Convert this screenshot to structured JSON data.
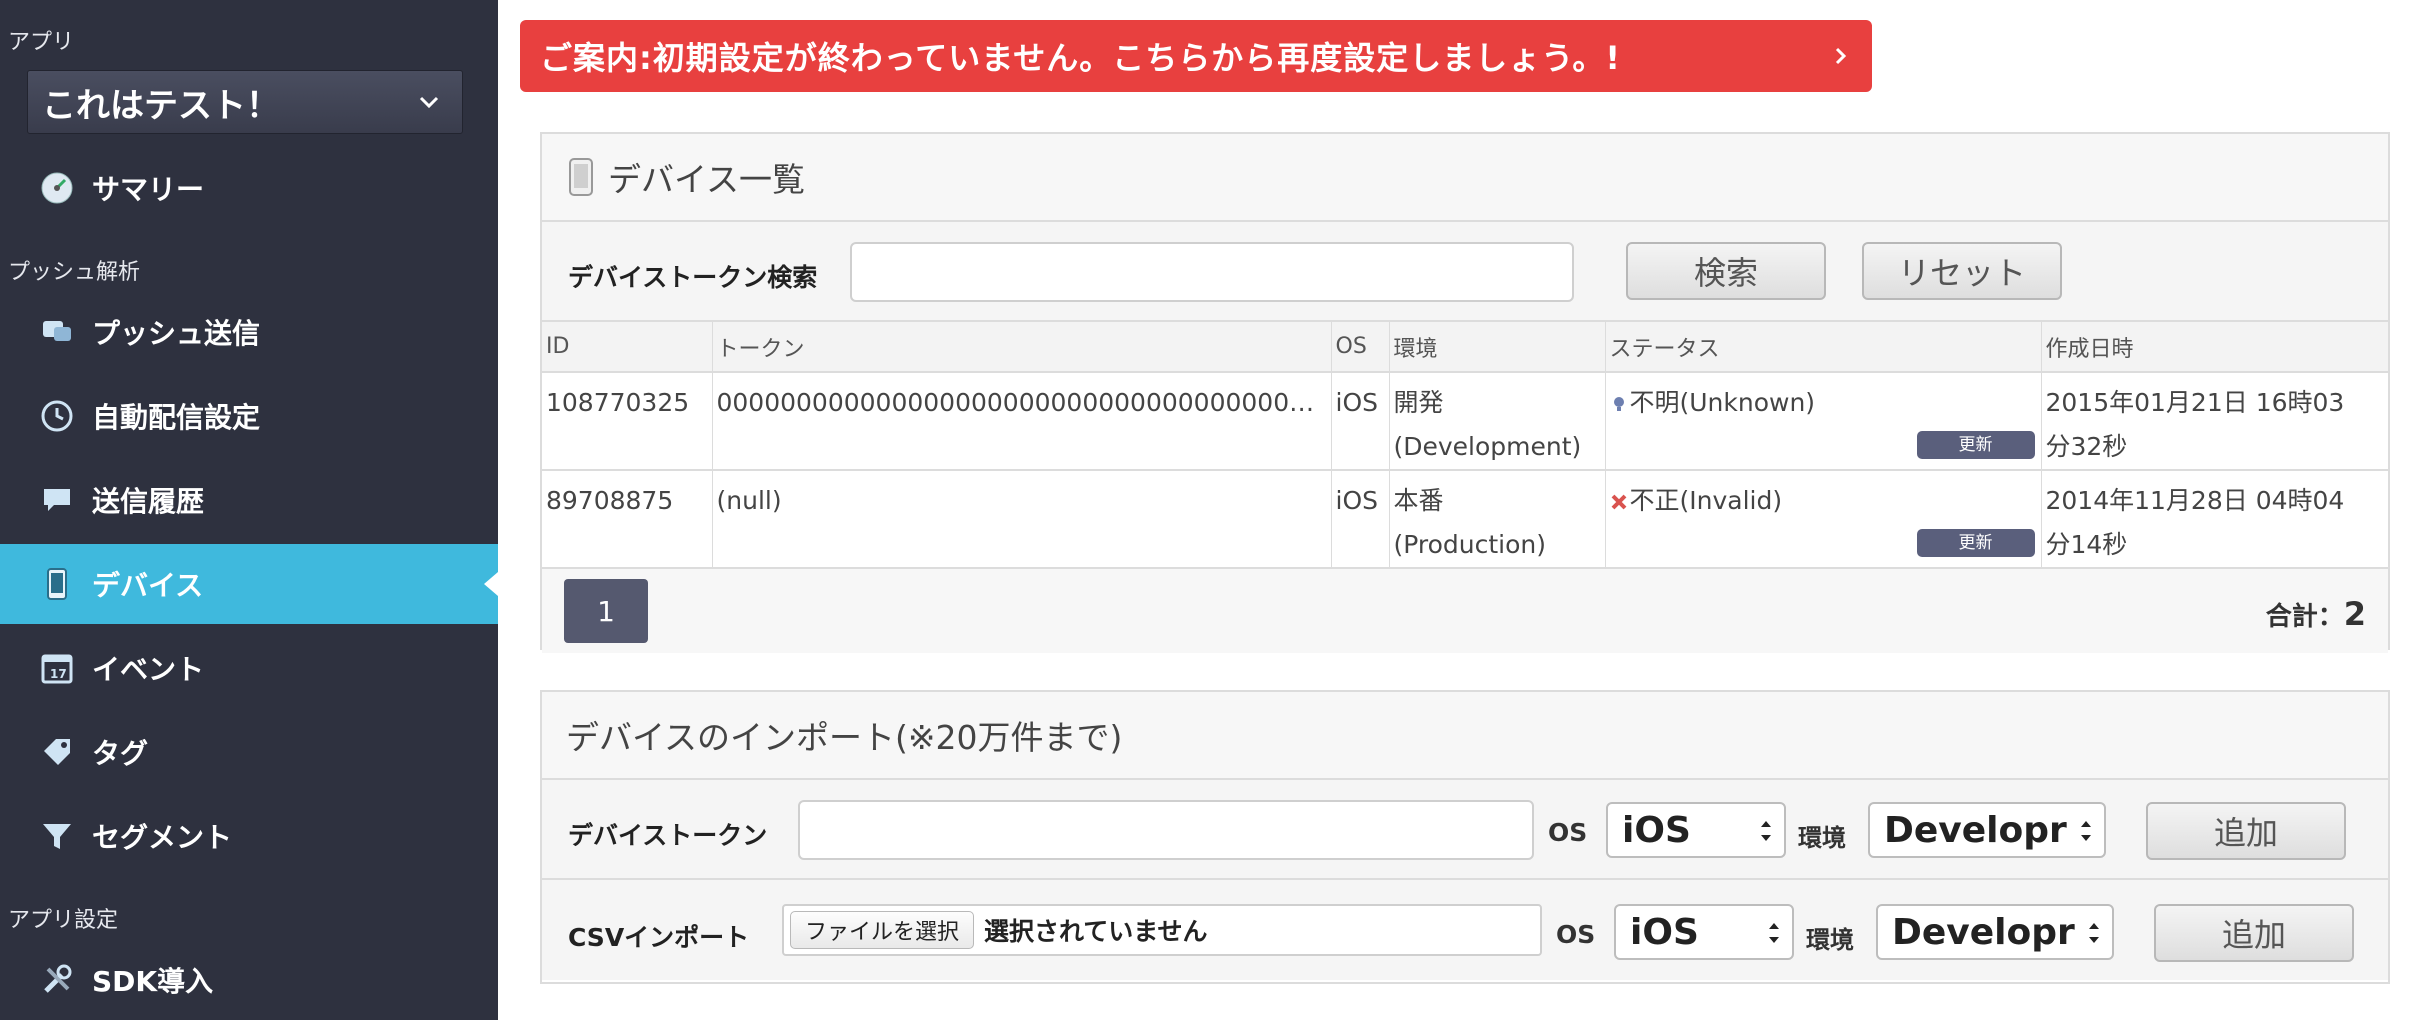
{
  "sidebar": {
    "section_app": "アプリ",
    "app_selected": "これはテスト！",
    "item_summary": "サマリー",
    "section_push": "プッシュ解析",
    "item_push_send": "プッシュ送信",
    "item_auto": "自動配信設定",
    "item_history": "送信履歴",
    "item_device": "デバイス",
    "item_event": "イベント",
    "item_tag": "タグ",
    "item_segment": "セグメント",
    "section_app_settings": "アプリ設定",
    "item_sdk": "SDK導入"
  },
  "alert": {
    "text": "ご案内:初期設定が終わっていません。こちらから再度設定しましょう。!"
  },
  "devices": {
    "title": "デバイス一覧",
    "search_label": "デバイストークン検索",
    "search_button": "検索",
    "reset_button": "リセット",
    "columns": [
      "ID",
      "トークン",
      "OS",
      "環境",
      "ステータス",
      "作成日時"
    ],
    "rows": [
      {
        "id": "108770325",
        "token": "00000000000000000000000000000000000000000000000000000000000000",
        "os": "iOS",
        "env_line1": "開発",
        "env_line2": "(Development)",
        "status": "不明(Unknown)",
        "update": "更新",
        "created_line1": "2015年01月21日 16時03",
        "created_line2": "分32秒"
      },
      {
        "id": "89708875",
        "token": "(null)",
        "os": "iOS",
        "env_line1": "本番",
        "env_line2": "(Production)",
        "status": "不正(Invalid)",
        "update": "更新",
        "created_line1": "2014年11月28日 04時04",
        "created_line2": "分14秒"
      }
    ],
    "page": "1",
    "total_label": "合計：",
    "total_value": "2"
  },
  "import": {
    "title": "デバイスのインポート(※20万件まで)",
    "token_label": "デバイストークン",
    "os_label": "OS",
    "os_value": "iOS",
    "env_label": "環境",
    "env_value": "Developr",
    "add_button": "追加",
    "csv_label": "CSVインポート",
    "file_button": "ファイルを選択",
    "file_none": "選択されていません"
  },
  "colors": {
    "sidebar_bg": "#2e313f",
    "sidebar_active": "#3fb9dd",
    "alert_bg": "#e8403f",
    "update_button": "#5a5f7c"
  }
}
